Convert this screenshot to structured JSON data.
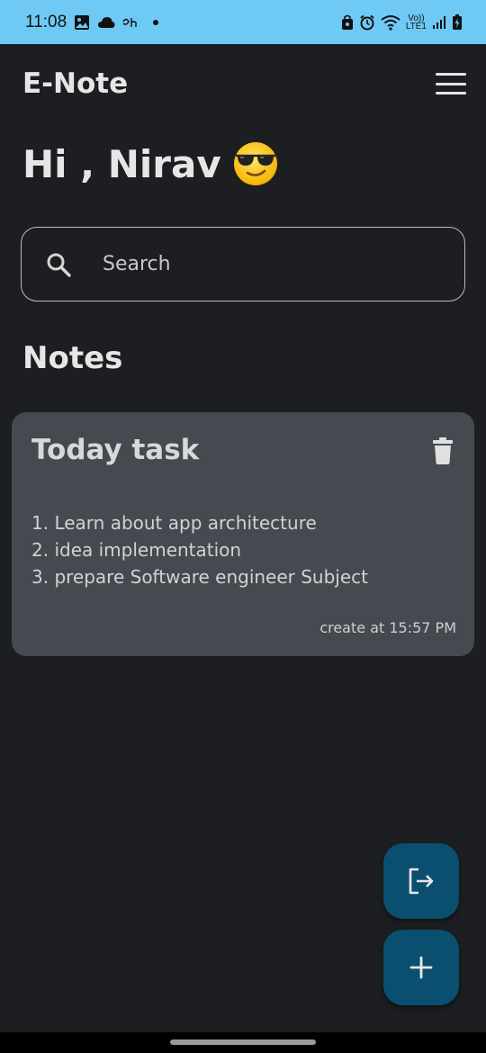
{
  "status_bar": {
    "time": "11:08",
    "network_label_top": "Vo))",
    "network_label_bottom": "LTE1"
  },
  "app_bar": {
    "title": "E-Note"
  },
  "greeting": {
    "text": "Hi , Nirav"
  },
  "search": {
    "placeholder": "Search"
  },
  "notes_section": {
    "title": "Notes"
  },
  "notes": [
    {
      "title": "Today task",
      "lines": [
        "1. Learn about app architecture",
        "2. idea implementation",
        "3. prepare Software engineer Subject"
      ],
      "created": "create at 15:57 PM"
    }
  ],
  "colors": {
    "background": "#1c1e21",
    "status_bar": "#6fc9f5",
    "card": "#454a51",
    "fab": "#0b4f70"
  }
}
